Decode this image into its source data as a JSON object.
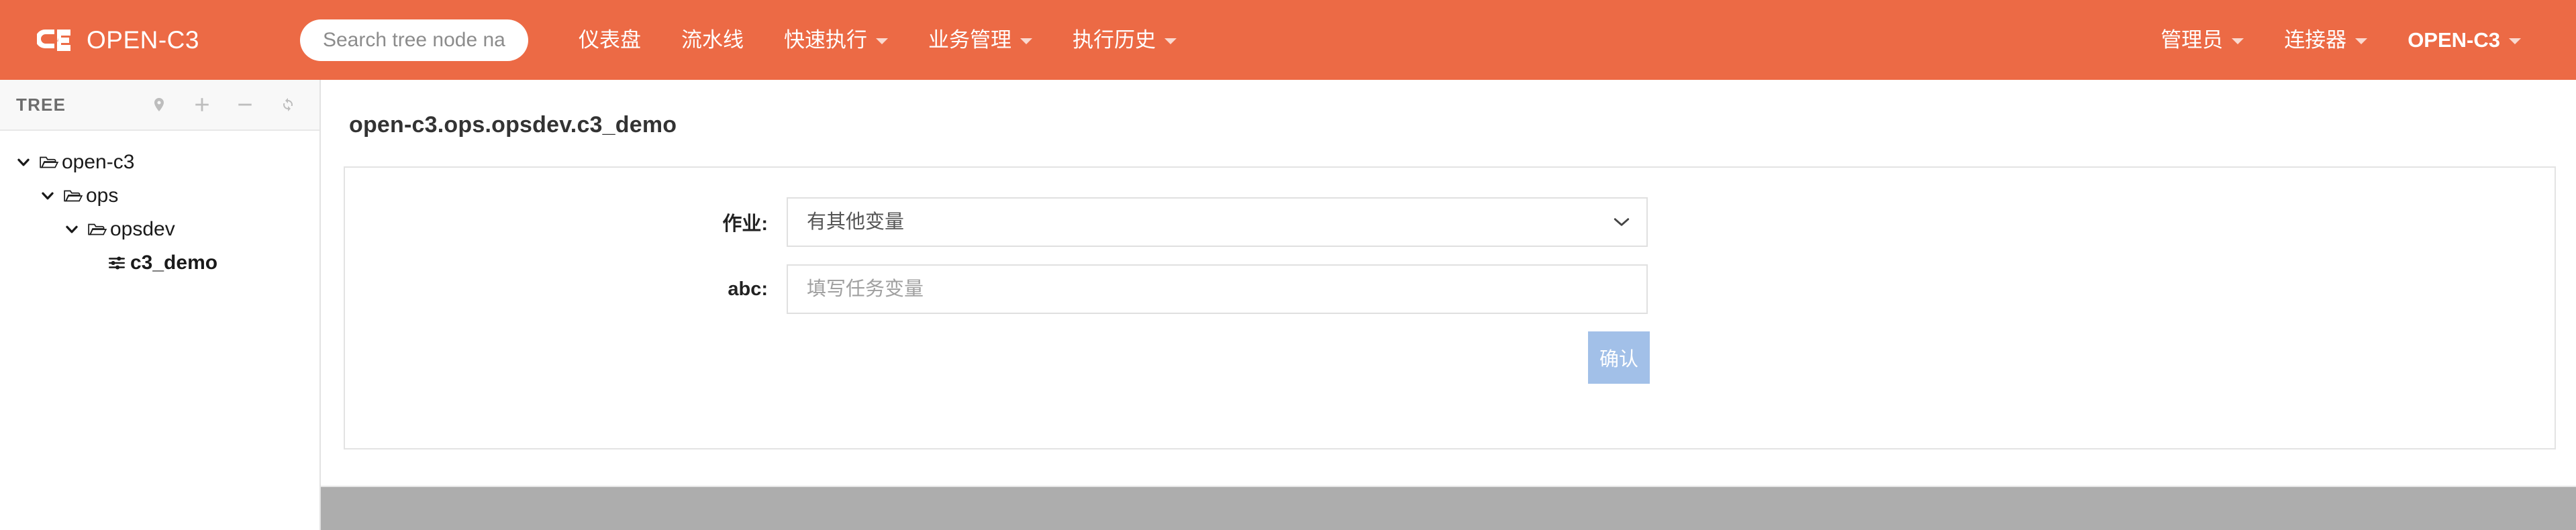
{
  "navbar": {
    "brand": "OPEN-C3",
    "brand_logo_icon": "c3-logo-icon",
    "accent_color": "#ec6a45",
    "search": {
      "placeholder": "Search tree node name",
      "value": ""
    },
    "left_items": [
      {
        "label": "仪表盘",
        "has_caret": false
      },
      {
        "label": "流水线",
        "has_caret": false
      },
      {
        "label": "快速执行",
        "has_caret": true
      },
      {
        "label": "业务管理",
        "has_caret": true
      },
      {
        "label": "执行历史",
        "has_caret": true
      }
    ],
    "right_items": [
      {
        "label": "管理员",
        "has_caret": true,
        "bold": false
      },
      {
        "label": "连接器",
        "has_caret": true,
        "bold": false
      },
      {
        "label": "OPEN-C3",
        "has_caret": true,
        "bold": true
      }
    ]
  },
  "sidebar": {
    "title": "TREE",
    "tools": [
      {
        "icon": "location-pin-icon",
        "name": "locate-node-button"
      },
      {
        "icon": "plus-icon",
        "name": "add-node-button"
      },
      {
        "icon": "minus-icon",
        "name": "remove-node-button"
      },
      {
        "icon": "refresh-icon",
        "name": "refresh-tree-button"
      }
    ],
    "tree": [
      {
        "label": "open-c3",
        "depth": 0,
        "expanded": true,
        "icon": "folder-open-icon",
        "selected": false
      },
      {
        "label": "ops",
        "depth": 1,
        "expanded": true,
        "icon": "folder-open-icon",
        "selected": false
      },
      {
        "label": "opsdev",
        "depth": 2,
        "expanded": true,
        "icon": "folder-open-icon",
        "selected": false
      },
      {
        "label": "c3_demo",
        "depth": 3,
        "expanded": false,
        "icon": "sliders-icon",
        "selected": true
      }
    ]
  },
  "main": {
    "page_title": "open-c3.ops.opsdev.c3_demo",
    "form": {
      "job_field": {
        "label": "作业:",
        "selected_option": "有其他变量",
        "options": [
          "有其他变量"
        ]
      },
      "abc_field": {
        "label": "abc:",
        "placeholder": "填写任务变量",
        "value": ""
      },
      "submit_label": "确认",
      "submit_color": "#a2c0e8"
    }
  },
  "footer": {
    "band_color": "#adadad"
  }
}
